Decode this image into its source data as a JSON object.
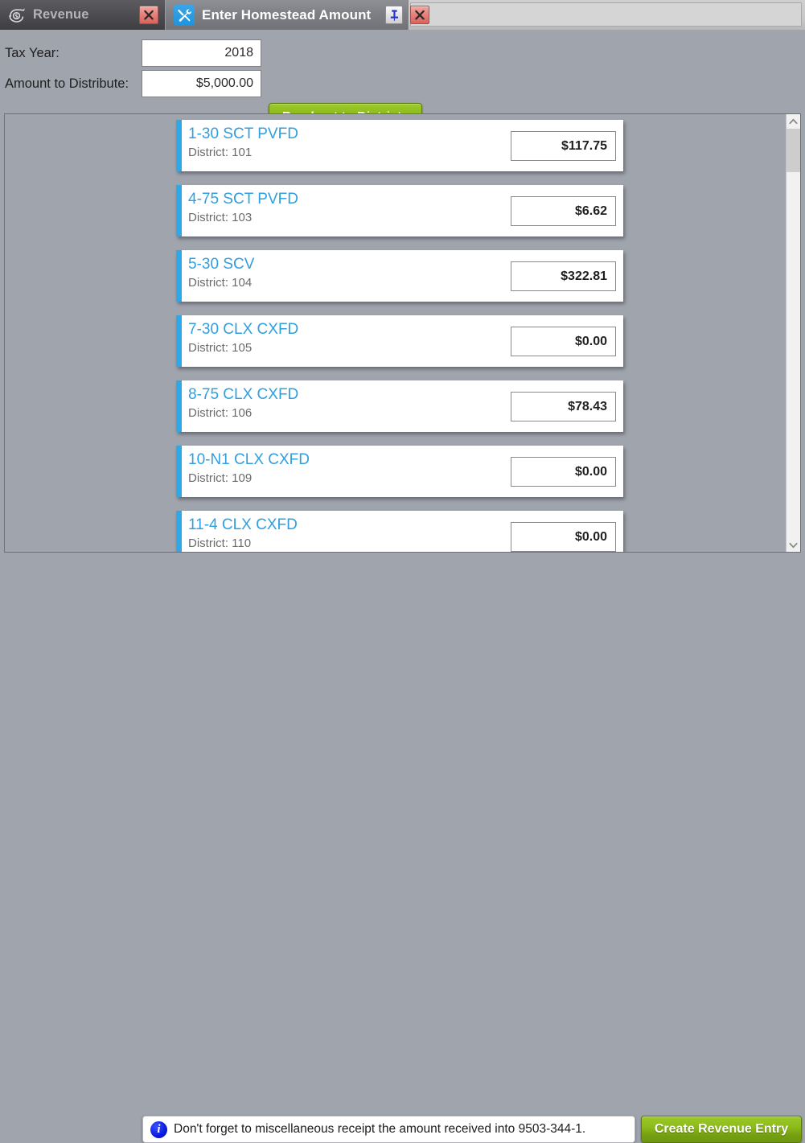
{
  "window": {
    "tabs": [
      {
        "id": "revenue",
        "label": "Revenue",
        "icon": "revenue-dollar-arrow-icon",
        "active": false,
        "close_label": "✕"
      },
      {
        "id": "enter-homestead-amount",
        "label": "Enter Homestead Amount",
        "icon": "tools-wrench-screwdriver-icon",
        "active": true,
        "pin_label": "📌",
        "close_label": "✕"
      }
    ]
  },
  "form": {
    "tax_year": {
      "label": "Tax Year:",
      "value": "2018",
      "placeholder": ""
    },
    "amount_to_distribute": {
      "label": "Amount to Distribute:",
      "value": "$5,000.00",
      "placeholder": ""
    },
    "breakout_button_label": "Breakout to Districts"
  },
  "list": {
    "sub_label": "District:",
    "items": [
      {
        "name": "1-30 SCT PVFD",
        "district": "101",
        "amount": "$117.75"
      },
      {
        "name": "4-75 SCT PVFD",
        "district": "103",
        "amount": "$6.62"
      },
      {
        "name": "5-30 SCV",
        "district": "104",
        "amount": "$322.81"
      },
      {
        "name": "7-30 CLX CXFD",
        "district": "105",
        "amount": "$0.00"
      },
      {
        "name": "8-75 CLX CXFD",
        "district": "106",
        "amount": "$78.43"
      },
      {
        "name": "10-N1 CLX CXFD",
        "district": "109",
        "amount": "$0.00"
      },
      {
        "name": "11-4 CLX CXFD",
        "district": "110",
        "amount": "$0.00"
      }
    ]
  },
  "scrollbar": {
    "up_arrow": "⌃",
    "down_arrow": "⌄"
  },
  "footer": {
    "info_icon": "info-circle-icon",
    "info_message": "Don't forget to miscellaneous receipt the amount received into 9503-344-1.",
    "create_button_label": "Create Revenue Entry"
  },
  "colors": {
    "accent_blue": "#2fa8e8",
    "title_blue": "#2f9fe0",
    "green_button": "#8bbb1a",
    "background_gray": "#a0a4ad",
    "info_blue": "#0a1ae0"
  }
}
